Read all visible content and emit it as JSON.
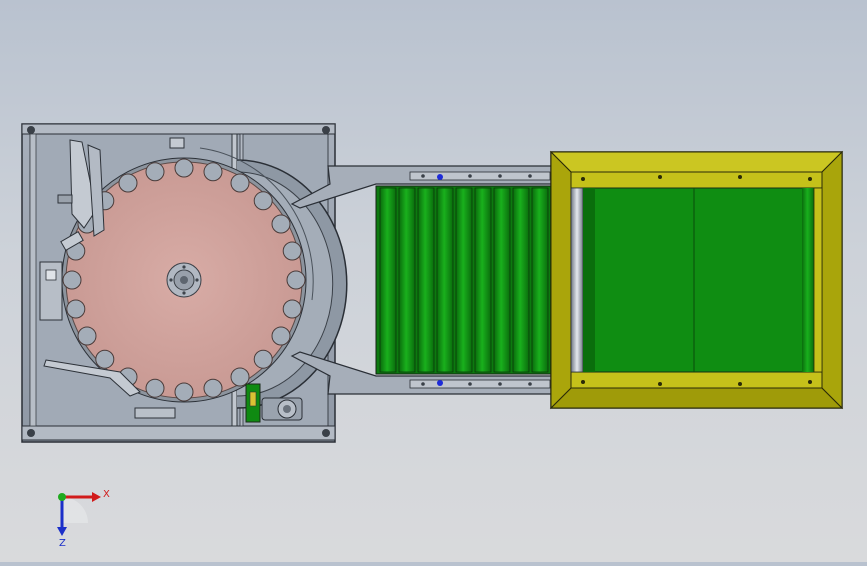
{
  "viewport": {
    "type": "CAD 3D model viewport (top view)",
    "background_color_top": "#b9c2cf",
    "background_color_bottom": "#d9dadc"
  },
  "model": {
    "parts": [
      "machine-frame",
      "rotary-turntable",
      "pinion-gear",
      "sensor-bracket",
      "drive-motor",
      "transfer-chute",
      "roller-conveyor",
      "collection-bin"
    ],
    "colors": {
      "frame": "#9aa3b0",
      "turntable": "#d6a8a2",
      "conveyor_green": "#0f8a12",
      "bin_yellow": "#b6b20c",
      "metal": "#8e98a4"
    }
  },
  "triad": {
    "x_label": "X",
    "z_label": "Z",
    "x_color": "#d11b1b",
    "z_color": "#1b2fc9",
    "y_color": "#1faa1f"
  }
}
